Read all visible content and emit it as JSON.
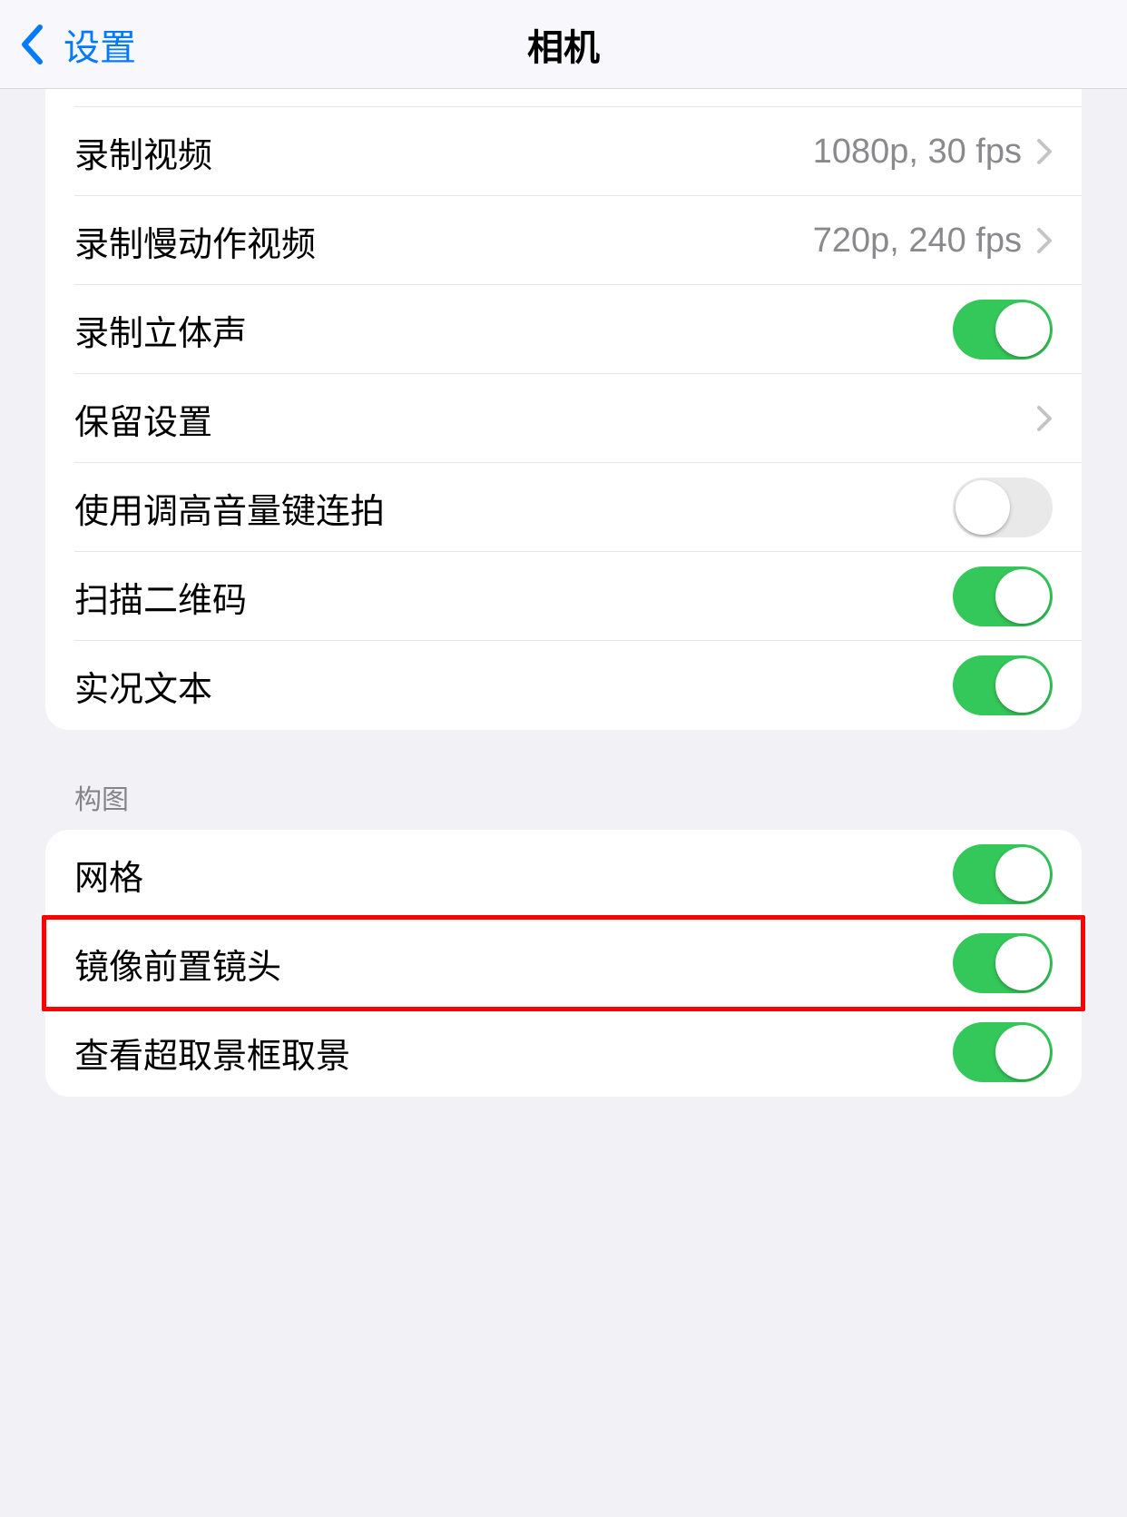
{
  "nav": {
    "back_label": "设置",
    "title": "相机"
  },
  "group1": {
    "record_video": {
      "label": "录制视频",
      "value": "1080p, 30 fps"
    },
    "record_slomo": {
      "label": "录制慢动作视频",
      "value": "720p, 240 fps"
    },
    "stereo_sound": {
      "label": "录制立体声",
      "on": true
    },
    "preserve_settings": {
      "label": "保留设置"
    },
    "volume_burst": {
      "label": "使用调高音量键连拍",
      "on": false
    },
    "scan_qr": {
      "label": "扫描二维码",
      "on": true
    },
    "live_text": {
      "label": "实况文本",
      "on": true
    }
  },
  "group2_header": "构图",
  "group2": {
    "grid": {
      "label": "网格",
      "on": true
    },
    "mirror_front": {
      "label": "镜像前置镜头",
      "on": true
    },
    "view_outside_frame": {
      "label": "查看超取景框取景",
      "on": true
    }
  },
  "colors": {
    "accent_blue": "#007aff",
    "switch_green": "#34c759",
    "highlight_red": "#ff0000"
  }
}
